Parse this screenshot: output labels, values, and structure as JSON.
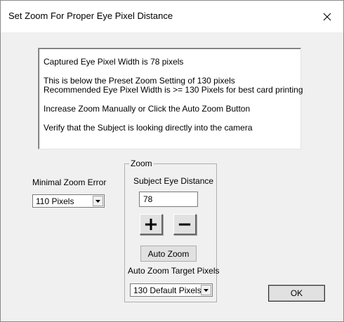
{
  "window": {
    "title": "Set Zoom For Proper Eye Pixel Distance"
  },
  "message": {
    "line1": "Captured Eye Pixel Width is 78 pixels",
    "line2": "This is below the Preset Zoom Setting of 130 pixels",
    "line3": "Recommended Eye Pixel Width is >= 130 Pixels for best card printing",
    "line4": "Increase Zoom Manually or Click the Auto Zoom Button",
    "line5": "Verify that the Subject is looking directly into the camera"
  },
  "minimal_zoom": {
    "label": "Minimal Zoom Error",
    "selected": "110 Pixels"
  },
  "zoom_group": {
    "legend": "Zoom",
    "eye_distance_label": "Subject Eye Distance",
    "eye_distance_value": "78",
    "plus_label": "+",
    "minus_label": "−",
    "auto_zoom_label": "Auto Zoom",
    "target_label": "Auto Zoom Target Pixels",
    "target_selected": "130 Default Pixels"
  },
  "buttons": {
    "ok_label": "OK"
  },
  "icons": {
    "close": "close-icon",
    "dropdown": "chevron-down-icon"
  }
}
